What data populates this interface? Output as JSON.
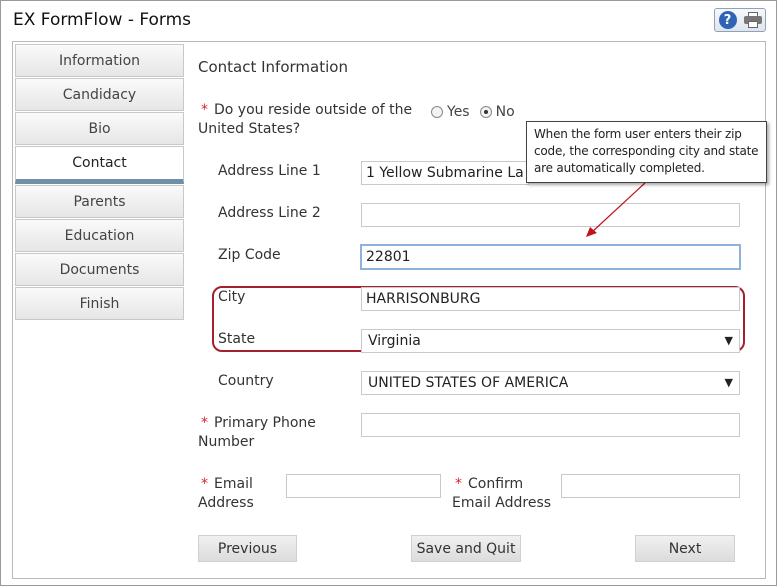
{
  "app": {
    "title": "EX FormFlow - Forms"
  },
  "header_icons": {
    "help": "help-icon",
    "print": "print-icon",
    "help_glyph": "?"
  },
  "sidebar": {
    "items": [
      {
        "label": "Information",
        "active": false
      },
      {
        "label": "Candidacy",
        "active": false
      },
      {
        "label": "Bio",
        "active": false
      },
      {
        "label": "Contact",
        "active": true
      },
      {
        "label": "Parents",
        "active": false
      },
      {
        "label": "Education",
        "active": false
      },
      {
        "label": "Documents",
        "active": false
      },
      {
        "label": "Finish",
        "active": false
      }
    ]
  },
  "form": {
    "section_title": "Contact Information",
    "reside_outside": {
      "required_mark": "*",
      "label_line1": "Do you reside outside of the",
      "label_line2": "United States?",
      "options": [
        "Yes",
        "No"
      ],
      "selected": "No"
    },
    "address1": {
      "label": "Address Line 1",
      "value": "1 Yellow Submarine La"
    },
    "address2": {
      "label": "Address Line 2",
      "value": ""
    },
    "zip": {
      "label": "Zip Code",
      "value": "22801"
    },
    "city": {
      "label": "City",
      "value": "HARRISONBURG"
    },
    "state": {
      "label": "State",
      "value": "Virginia"
    },
    "country": {
      "label": "Country",
      "value": "UNITED STATES OF AMERICA"
    },
    "phone": {
      "required_mark": "*",
      "label_line1": "Primary Phone",
      "label_line2": "Number",
      "value": ""
    },
    "email": {
      "required_mark": "*",
      "label_line1": "Email",
      "label_line2": "Address",
      "value": ""
    },
    "confirm_email": {
      "required_mark": "*",
      "label_line1": "Confirm",
      "label_line2": "Email Address",
      "value": ""
    }
  },
  "callout": {
    "text": "When the form user enters their zip code, the corresponding city and state are automatically completed."
  },
  "buttons": {
    "previous": "Previous",
    "save_quit": "Save and Quit",
    "next": "Next"
  },
  "colors": {
    "highlight": "#a4202c",
    "required": "#d9242f",
    "active_tab_bar": "#6e8fa8"
  }
}
